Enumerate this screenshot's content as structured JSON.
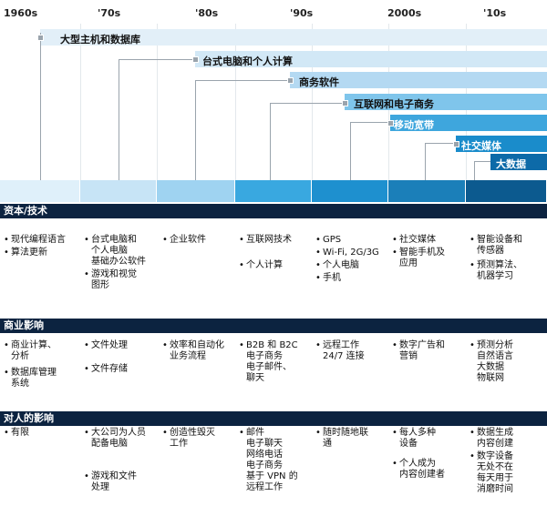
{
  "decades": [
    "1960s",
    "'70s",
    "'80s",
    "'90s",
    "2000s",
    "'10s"
  ],
  "eras": [
    {
      "label": "大型主机和数据库",
      "color": "#dcebf7"
    },
    {
      "label": "台式电脑和个人计算",
      "color": "#cfe6f6"
    },
    {
      "label": "商务软件",
      "color": "#b6d9f1"
    },
    {
      "label": "互联网和电子商务",
      "color": "#7ec4ea"
    },
    {
      "label": "移动宽带",
      "color": "#3ea4dc"
    },
    {
      "label": "社交媒体",
      "color": "#1a8cc9"
    },
    {
      "label": "大数据",
      "color": "#0d6aa8"
    }
  ],
  "strip_colors": [
    "#dff0fa",
    "#c7e4f6",
    "#9fd3f1",
    "#39a8e0",
    "#1e90cf",
    "#1b7fb9",
    "#0c5a8f"
  ],
  "sections": [
    {
      "title": "资本/技术",
      "columns": [
        [
          "现代编程语言",
          "算法更新"
        ],
        [
          "台式电脑和\n个人电脑\n基础办公软件",
          "游戏和视觉\n图形"
        ],
        [
          "企业软件"
        ],
        [
          "互联网技术",
          "个人计算"
        ],
        [
          "GPS",
          "Wi-Fi, 2G/3G",
          "个人电脑",
          "手机"
        ],
        [
          "社交媒体",
          "智能手机及\n应用"
        ],
        [
          "智能设备和\n传感器",
          "预测算法、\n机器学习"
        ]
      ]
    },
    {
      "title": "商业影响",
      "columns": [
        [
          "商业计算、\n分析",
          "数据库管理\n系统"
        ],
        [
          "文件处理",
          "文件存储"
        ],
        [
          "效率和自动化\n业务流程"
        ],
        [
          "B2B 和 B2C\n电子商务\n电子邮件、\n聊天"
        ],
        [
          "远程工作\n24/7 连接"
        ],
        [
          "数字广告和\n营销"
        ],
        [
          "预测分析\n自然语言\n大数据\n物联网"
        ]
      ]
    },
    {
      "title": "对人的影响",
      "columns": [
        [
          "有限"
        ],
        [
          "大公司为人员\n配备电脑",
          "游戏和文件\n处理"
        ],
        [
          "创造性毁灭\n工作"
        ],
        [
          "邮件\n电子聊天\n网络电话\n电子商务\n基于 VPN 的\n远程工作"
        ],
        [
          "随时随地联\n通"
        ],
        [
          "每人多种\n设备",
          "个人成为\n内容创建者"
        ],
        [
          "数据生成\n内容创建",
          "数字设备\n无处不在\n每天用于\n消磨时间"
        ]
      ]
    }
  ]
}
